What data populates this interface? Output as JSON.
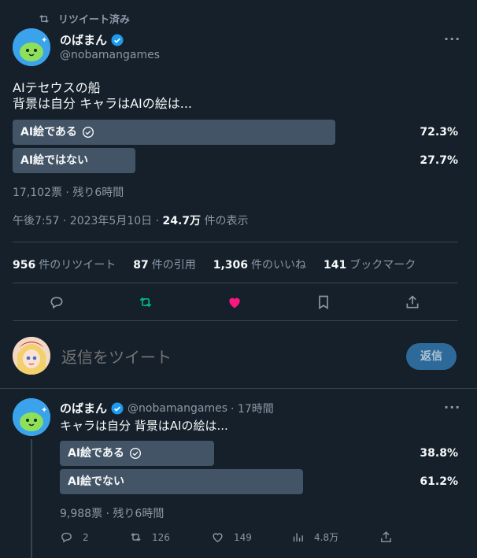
{
  "retweet_banner": "リツイート済み",
  "main_tweet": {
    "author_name": "のばまん",
    "author_handle": "@nobamangames",
    "more": "···",
    "text_line1": "AIテセウスの船",
    "text_line2": "背景は自分 キャラはAIの絵は...",
    "poll": {
      "options": [
        {
          "label": "AI絵である",
          "percent_text": "72.3%",
          "percent": 72.3,
          "winner": true
        },
        {
          "label": "AI絵ではない",
          "percent_text": "27.7%",
          "percent": 27.7,
          "winner": false
        }
      ],
      "summary": "17,102票 · 残り6時間"
    },
    "timestamp": "午後7:57 · 2023年5月10日 · ",
    "views_count": "24.7万",
    "views_label": " 件の表示",
    "stats": {
      "retweets_count": "956",
      "retweets_label": "件のリツイート",
      "quotes_count": "87",
      "quotes_label": "件の引用",
      "likes_count": "1,306",
      "likes_label": "件のいいね",
      "bookmarks_count": "141",
      "bookmarks_label": "ブックマーク"
    }
  },
  "reply_box": {
    "placeholder": "返信をツイート",
    "button": "返信"
  },
  "reply_tweet": {
    "author_name": "のばまん",
    "author_handle": "@nobamangames",
    "time": " · 17時間",
    "more": "···",
    "text": "キャラは自分 背景はAIの絵は...",
    "poll": {
      "options": [
        {
          "label": "AI絵である",
          "percent_text": "38.8%",
          "percent": 38.8,
          "winner": true
        },
        {
          "label": "AI絵でない",
          "percent_text": "61.2%",
          "percent": 61.2,
          "winner": false
        }
      ],
      "summary": "9,988票 · 残り6時間"
    },
    "actions": {
      "replies": "2",
      "retweets": "126",
      "likes": "149",
      "views": "4.8万"
    }
  },
  "colors": {
    "background": "#15202b",
    "bar": "#425466",
    "retweet_active": "#00ba7c",
    "like_active": "#f91880",
    "verified": "#1d9bf0"
  }
}
